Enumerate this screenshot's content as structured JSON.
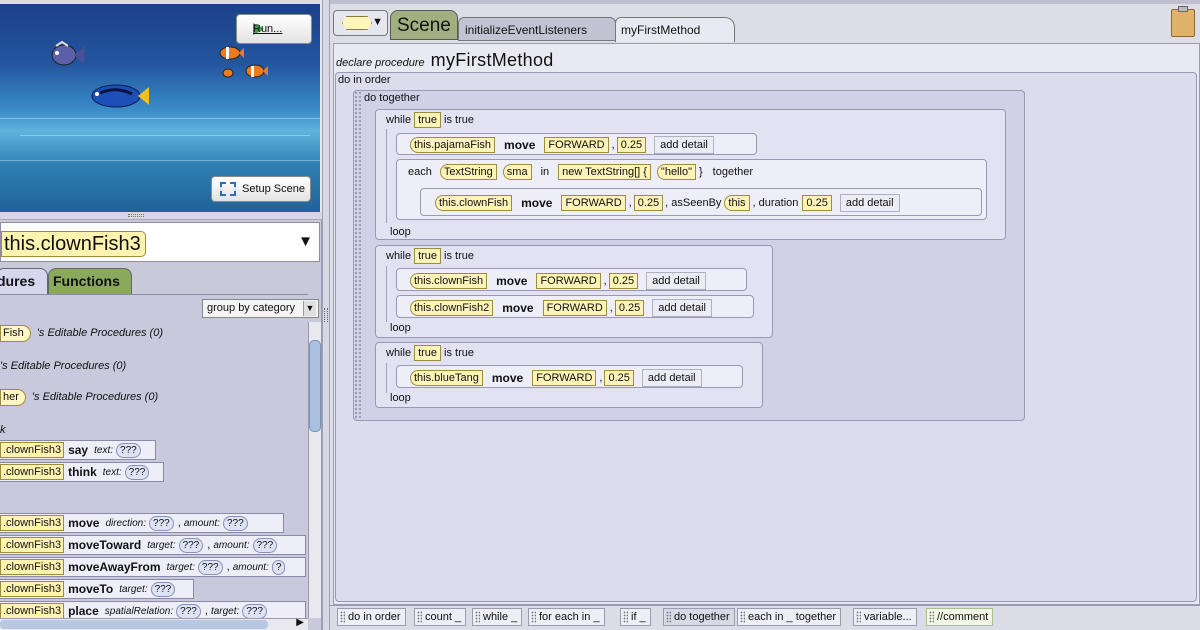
{
  "scene_panel": {
    "run_label": "Run...",
    "setup_label": "Setup Scene"
  },
  "instance_selector": {
    "selected": "this.clownFish3"
  },
  "palette_tabs": {
    "procedures": "dures",
    "functions": "Functions"
  },
  "group_by": {
    "selected": "group by category"
  },
  "palette": {
    "editable_1": {
      "pill": "Fish",
      "text": "'s Editable Procedures (0)"
    },
    "editable_2": {
      "text": "'s Editable Procedures (0)"
    },
    "editable_3": {
      "pill": "her",
      "text": "'s Editable Procedures (0)"
    },
    "category_k": "k",
    "say": {
      "receiver": ".clownFish3",
      "name": "say",
      "p1": "text:",
      "v1": "???"
    },
    "think": {
      "receiver": ".clownFish3",
      "name": "think",
      "p1": "text:",
      "v1": "???"
    },
    "move": {
      "receiver": ".clownFish3",
      "name": "move",
      "p1": "direction:",
      "v1": "???",
      "p2": "amount:",
      "v2": "???"
    },
    "moveToward": {
      "receiver": ".clownFish3",
      "name": "moveToward",
      "p1": "target:",
      "v1": "???",
      "p2": "amount:",
      "v2": "???"
    },
    "moveAwayFrom": {
      "receiver": ".clownFish3",
      "name": "moveAwayFrom",
      "p1": "target:",
      "v1": "???",
      "p2": "amount:",
      "v2": "?"
    },
    "moveTo": {
      "receiver": ".clownFish3",
      "name": "moveTo",
      "p1": "target:",
      "v1": "???"
    },
    "place": {
      "receiver": ".clownFish3",
      "name": "place",
      "p1": "spatialRelation:",
      "v1": "???",
      "p2": "target:",
      "v2": "???"
    }
  },
  "editor_tabs": {
    "scene": "Scene",
    "init": "initializeEventListeners",
    "method": "myFirstMethod"
  },
  "procedure": {
    "declare": "declare procedure",
    "name": "myFirstMethod",
    "do_in_order": "do in order",
    "do_together": "do together",
    "while": "while",
    "true": "true",
    "is_true": "is true",
    "loop": "loop",
    "move": "move",
    "forward": "FORWARD",
    "amount": "0.25",
    "comma": ",",
    "add_detail": "add detail",
    "each": "each",
    "each_type": "TextString",
    "each_var": "sma",
    "in": "in",
    "new_array": "new TextString[] {",
    "hello": "\"hello\"",
    "close_brace": "}",
    "together": "together",
    "as_seen_by": ", asSeenBy",
    "this": "this",
    "duration": ", duration",
    "pajamaFish": "this.pajamaFish",
    "clownFish": "this.clownFish",
    "clownFish2": "this.clownFish2",
    "blueTang": "this.blueTang"
  },
  "bottom_tiles": [
    "do in order",
    "count _",
    "while _",
    "for each in _",
    "if _",
    "do together",
    "each in _ together",
    "variable...",
    "//comment"
  ],
  "colors": {
    "scene_tab": "#9fb07e",
    "functions_tab": "#8aa95c",
    "object_tile": "#fff4b8"
  }
}
